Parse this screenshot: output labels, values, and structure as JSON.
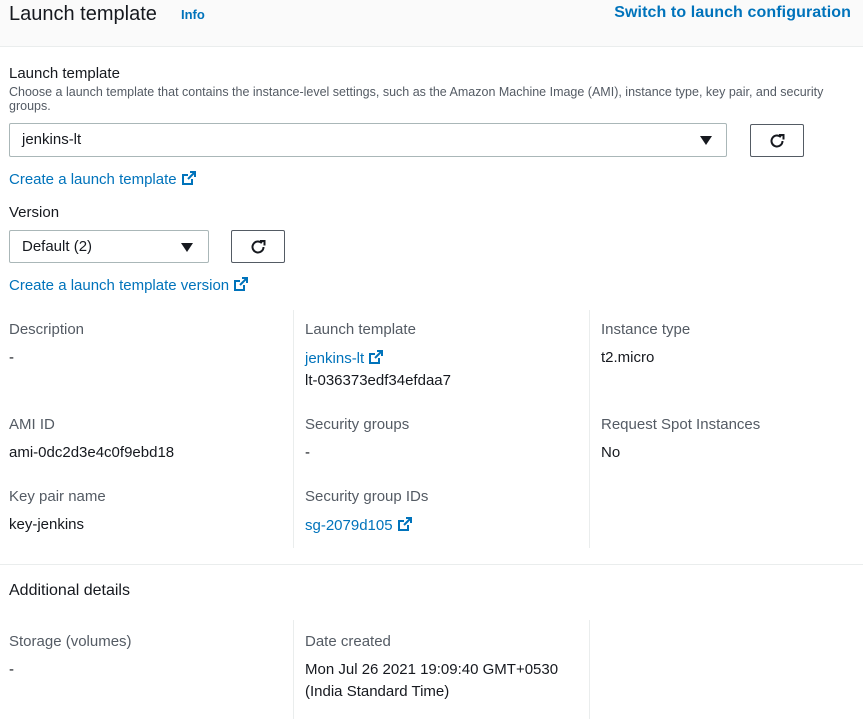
{
  "header": {
    "title": "Launch template",
    "info": "Info",
    "switch_link": "Switch to launch configuration"
  },
  "template_field": {
    "label": "Launch template",
    "description": "Choose a launch template that contains the instance-level settings, such as the Amazon Machine Image (AMI), instance type, key pair, and security groups.",
    "selected": "jenkins-lt",
    "create_link": "Create a launch template"
  },
  "version_field": {
    "label": "Version",
    "selected": "Default (2)",
    "create_link": "Create a launch template version"
  },
  "details": {
    "description": {
      "label": "Description",
      "value": "-"
    },
    "launch_template": {
      "label": "Launch template",
      "link": "jenkins-lt",
      "id": "lt-036373edf34efdaa7"
    },
    "instance_type": {
      "label": "Instance type",
      "value": "t2.micro"
    },
    "ami_id": {
      "label": "AMI ID",
      "value": "ami-0dc2d3e4c0f9ebd18"
    },
    "security_groups": {
      "label": "Security groups",
      "value": "-"
    },
    "request_spot": {
      "label": "Request Spot Instances",
      "value": "No"
    },
    "key_pair": {
      "label": "Key pair name",
      "value": "key-jenkins"
    },
    "security_group_ids": {
      "label": "Security group IDs",
      "link": "sg-2079d105"
    }
  },
  "additional": {
    "title": "Additional details",
    "storage": {
      "label": "Storage (volumes)",
      "value": "-"
    },
    "date_created": {
      "label": "Date created",
      "value_line1": "Mon Jul 26 2021 19:09:40 GMT+0530",
      "value_line2": "(India Standard Time)"
    }
  },
  "colors": {
    "link": "#0073bb",
    "text": "#16191f",
    "secondary_text": "#545b64",
    "divider": "#eaeded"
  },
  "icons": [
    "external-link-icon",
    "refresh-icon",
    "caret-down-icon"
  ]
}
